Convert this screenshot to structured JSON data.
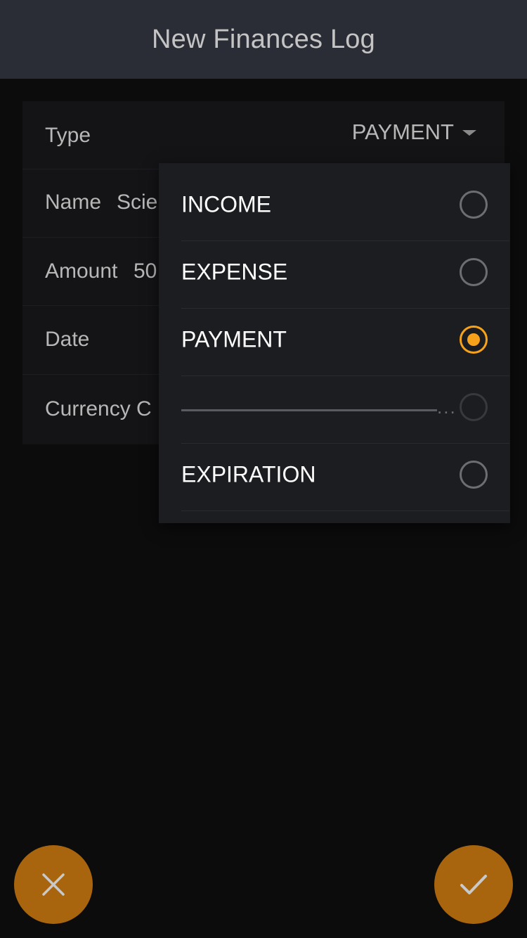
{
  "header": {
    "title": "New Finances Log"
  },
  "form": {
    "type": {
      "label": "Type",
      "selected": "PAYMENT"
    },
    "name": {
      "label": "Name",
      "value": "Scie"
    },
    "amount": {
      "label": "Amount",
      "value": "50"
    },
    "date": {
      "label": "Date"
    },
    "currency": {
      "label": "Currency C"
    }
  },
  "dropdown": {
    "options": [
      {
        "label": "INCOME",
        "checked": false
      },
      {
        "label": "EXPENSE",
        "checked": false
      },
      {
        "label": "PAYMENT",
        "checked": true
      },
      {
        "label": "",
        "separator_dots": "...",
        "disabled": true
      },
      {
        "label": "EXPIRATION",
        "checked": false
      }
    ]
  },
  "actions": {
    "cancel_icon": "close-icon",
    "confirm_icon": "check-icon",
    "accent_color": "#a8650e",
    "selected_color": "#f7a21b"
  }
}
